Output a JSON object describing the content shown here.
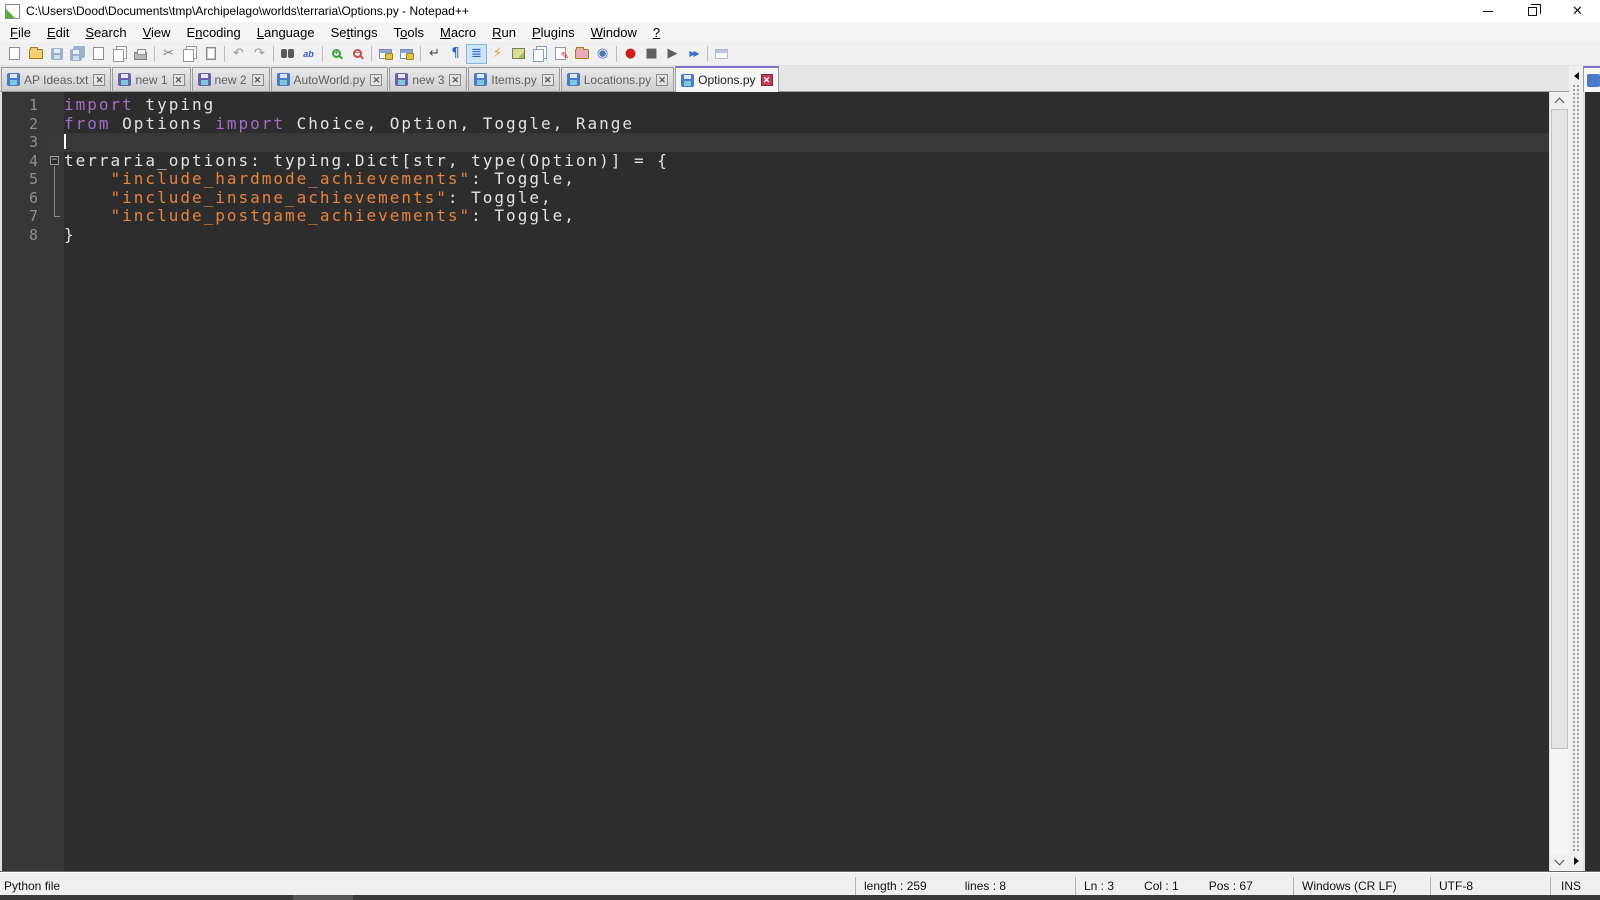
{
  "window": {
    "title": "C:\\Users\\Dood\\Documents\\tmp\\Archipelago\\worlds\\terraria\\Options.py - Notepad++",
    "controls": [
      {
        "name": "minimize-button",
        "icon": "minimize-icon"
      },
      {
        "name": "restore-button",
        "icon": "restore-icon"
      },
      {
        "name": "close-button",
        "icon": "close-icon",
        "glyph": "✕"
      }
    ]
  },
  "menu_bar": {
    "items": [
      {
        "pre": "",
        "key": "F",
        "post": "ile"
      },
      {
        "pre": "",
        "key": "E",
        "post": "dit"
      },
      {
        "pre": "",
        "key": "S",
        "post": "earch"
      },
      {
        "pre": "",
        "key": "V",
        "post": "iew"
      },
      {
        "pre": "E",
        "key": "n",
        "post": "coding"
      },
      {
        "pre": "",
        "key": "L",
        "post": "anguage"
      },
      {
        "pre": "Se",
        "key": "t",
        "post": "tings"
      },
      {
        "pre": "T",
        "key": "o",
        "post": "ols"
      },
      {
        "pre": "",
        "key": "M",
        "post": "acro"
      },
      {
        "pre": "",
        "key": "R",
        "post": "un"
      },
      {
        "pre": "",
        "key": "P",
        "post": "lugins"
      },
      {
        "pre": "",
        "key": "W",
        "post": "indow"
      },
      {
        "pre": "",
        "key": "?",
        "post": ""
      }
    ]
  },
  "toolbar": {
    "buttons": [
      {
        "name": "new-file",
        "kind": "page",
        "badge": "+",
        "badge_color": "#2fa432"
      },
      {
        "name": "open-file",
        "kind": "folder",
        "color": "#f3cf73"
      },
      {
        "name": "save-file",
        "kind": "floppy",
        "color": "#9fb0cc"
      },
      {
        "name": "save-all",
        "kind": "floppy2",
        "color": "#9fb0cc"
      },
      {
        "name": "close-file",
        "kind": "page",
        "badge": "−",
        "badge_color": "#e08a2e"
      },
      {
        "name": "close-all",
        "kind": "pages",
        "badge": "−",
        "badge_color": "#e08a2e"
      },
      {
        "name": "print",
        "kind": "printer",
        "sep_after": true
      },
      {
        "name": "cut",
        "kind": "glyph",
        "glyph": "✂",
        "color": "#7a7a7a"
      },
      {
        "name": "copy",
        "kind": "pages"
      },
      {
        "name": "paste",
        "kind": "clipboard",
        "sep_after": true
      },
      {
        "name": "undo",
        "kind": "glyph",
        "glyph": "↶",
        "color": "#9a9a9a"
      },
      {
        "name": "redo",
        "kind": "glyph",
        "glyph": "↷",
        "color": "#9a9a9a",
        "sep_after": true
      },
      {
        "name": "find",
        "kind": "binoculars"
      },
      {
        "name": "replace",
        "kind": "replace",
        "label": "ab",
        "sep_after": true
      },
      {
        "name": "zoom-in",
        "kind": "magnifier",
        "color": "#3f9e3f",
        "sign": "+"
      },
      {
        "name": "zoom-out",
        "kind": "magnifier",
        "color": "#c05050",
        "sign": "−",
        "sep_after": true
      },
      {
        "name": "synchronize-vertical-scrolling",
        "kind": "winlock"
      },
      {
        "name": "synchronize-horizontal-scrolling",
        "kind": "winlock",
        "sep_after": true
      },
      {
        "name": "word-wrap",
        "kind": "glyph",
        "glyph": "↵",
        "color": "#4a4a4a"
      },
      {
        "name": "show-all-characters",
        "kind": "glyph",
        "glyph": "¶",
        "color": "#2d5fd0"
      },
      {
        "name": "show-indent-guide",
        "kind": "glyph",
        "glyph": "≣",
        "color": "#2d5fd0",
        "pressed": true
      },
      {
        "name": "function-completion",
        "kind": "glyph",
        "glyph": "⚡",
        "color": "#e09a20"
      },
      {
        "name": "document-map",
        "kind": "map"
      },
      {
        "name": "document-switcher",
        "kind": "pages",
        "color": "#7aa0cc"
      },
      {
        "name": "edit-popup-marker",
        "kind": "pendoc"
      },
      {
        "name": "open-containing-folder",
        "kind": "folder",
        "color": "#e8aab8"
      },
      {
        "name": "view-monitoring",
        "kind": "glyph",
        "glyph": "◉",
        "color": "#4a7ab0",
        "sep_after": true
      },
      {
        "name": "start-macro-recording",
        "kind": "glyph",
        "glyph": "●",
        "color": "#cc2020"
      },
      {
        "name": "stop-macro-recording",
        "kind": "glyph",
        "glyph": "■",
        "color": "#606060"
      },
      {
        "name": "playback-macro",
        "kind": "glyph",
        "glyph": "▶",
        "color": "#606060"
      },
      {
        "name": "run-macro-multiple-times",
        "kind": "glyph2",
        "glyph": "▶▶",
        "color": "#3a70c0",
        "sep_after": true
      },
      {
        "name": "save-recorded-macro",
        "kind": "winlock-plain"
      }
    ]
  },
  "tab_bar": {
    "tabs": [
      {
        "label": "AP Ideas.txt",
        "state": "saved",
        "active": false
      },
      {
        "label": "new 1",
        "state": "new",
        "active": false
      },
      {
        "label": "new 2",
        "state": "new",
        "active": false
      },
      {
        "label": "AutoWorld.py",
        "state": "saved",
        "active": false
      },
      {
        "label": "new 3",
        "state": "new",
        "active": false
      },
      {
        "label": "Items.py",
        "state": "saved",
        "active": false
      },
      {
        "label": "Locations.py",
        "state": "saved",
        "active": false
      },
      {
        "label": "Options.py",
        "state": "saved",
        "active": true
      }
    ],
    "floppy_colors": {
      "saved": "#4a7ac8",
      "new": "#6f5fa8"
    }
  },
  "editor": {
    "colors": {
      "background": "#2d2d2d",
      "gutter": "#373737",
      "line_number": "#8f8f8f",
      "keyword": "#a46cc8",
      "string": "#e8823c",
      "plain": "#e2e2e2"
    },
    "lines": [
      {
        "n": "1",
        "fold": "",
        "caret": false,
        "segs": [
          {
            "c": "kw",
            "t": "import"
          },
          {
            "c": "pl",
            "t": " typing"
          }
        ]
      },
      {
        "n": "2",
        "fold": "",
        "caret": false,
        "segs": [
          {
            "c": "kw",
            "t": "from"
          },
          {
            "c": "pl",
            "t": " Options "
          },
          {
            "c": "kw",
            "t": "import"
          },
          {
            "c": "pl",
            "t": " Choice, Option, Toggle, Range"
          }
        ]
      },
      {
        "n": "3",
        "fold": "",
        "caret": true,
        "segs": []
      },
      {
        "n": "4",
        "fold": "open",
        "caret": false,
        "segs": [
          {
            "c": "pl",
            "t": "terraria_options: typing.Dict[str, type(Option)] = {"
          }
        ]
      },
      {
        "n": "5",
        "fold": "line",
        "caret": false,
        "segs": [
          {
            "c": "pl",
            "t": "    "
          },
          {
            "c": "str",
            "t": "\"include_hardmode_achievements\""
          },
          {
            "c": "pl",
            "t": ": Toggle,"
          }
        ]
      },
      {
        "n": "6",
        "fold": "line",
        "caret": false,
        "segs": [
          {
            "c": "pl",
            "t": "    "
          },
          {
            "c": "str",
            "t": "\"include_insane_achievements\""
          },
          {
            "c": "pl",
            "t": ": Toggle,"
          }
        ]
      },
      {
        "n": "7",
        "fold": "end",
        "caret": false,
        "segs": [
          {
            "c": "pl",
            "t": "    "
          },
          {
            "c": "str",
            "t": "\"include_postgame_achievements\""
          },
          {
            "c": "pl",
            "t": ": Toggle,"
          }
        ]
      },
      {
        "n": "8",
        "fold": "",
        "caret": false,
        "segs": [
          {
            "c": "pl",
            "t": "}"
          }
        ]
      }
    ],
    "fold_open_marker": "−"
  },
  "status_bar": {
    "doc_type": "Python file",
    "length_label": "length : 259",
    "lines_label": "lines : 8",
    "ln_label": "Ln : 3",
    "col_label": "Col : 1",
    "pos_label": "Pos : 67",
    "eol": "Windows (CR LF)",
    "encoding": "UTF-8",
    "insert_mode": "INS"
  }
}
